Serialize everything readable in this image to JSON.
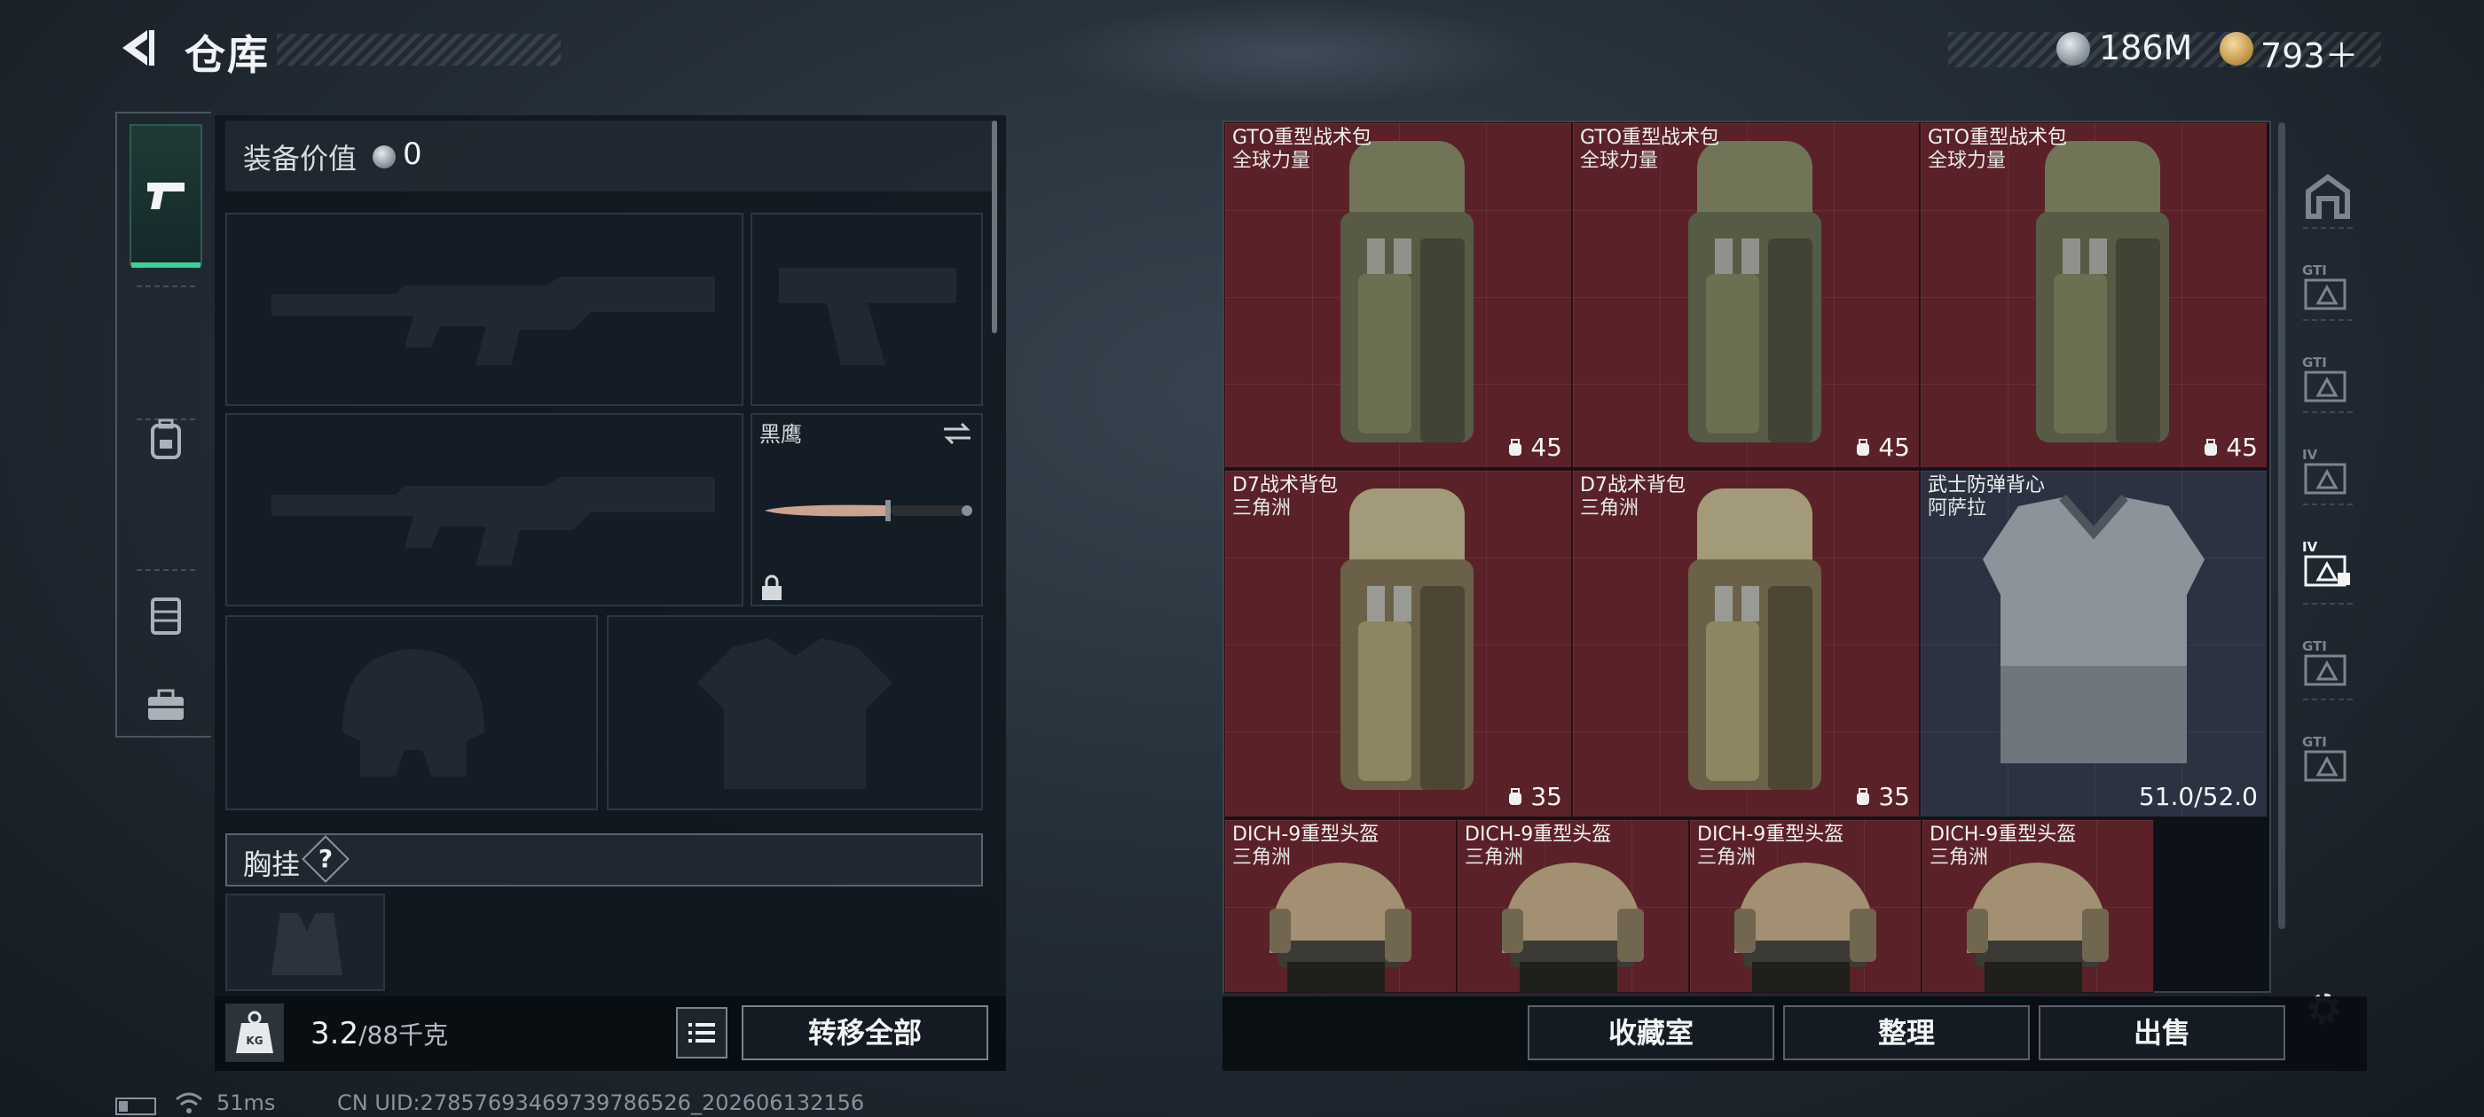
{
  "header": {
    "title": "仓库",
    "currency_silver": "186M",
    "currency_gold": "793＋"
  },
  "icons": {
    "back": "back-arrow-icon",
    "silver_coin": "silver-coin-icon",
    "gold_coin": "gold-coin-icon",
    "settings": "gear-icon"
  },
  "categories": [
    {
      "name": "weapons",
      "icon": "pistol-icon",
      "active": true
    },
    {
      "name": "backpack",
      "icon": "backpack-icon",
      "active": false
    },
    {
      "name": "vest",
      "icon": "chest-rig-icon",
      "active": false
    },
    {
      "name": "case",
      "icon": "briefcase-icon",
      "active": false
    }
  ],
  "loadout": {
    "value_label": "装备价值",
    "value": "0",
    "melee_name": "黑鹰",
    "chest_rig_label": "胸挂",
    "chest_rig_help": "?",
    "weight_current": "3.2",
    "weight_max": "/88千克",
    "weight_icon_text": "KG",
    "transfer_all": "转移全部"
  },
  "storage": {
    "items": [
      {
        "name": "GTO重型战术包",
        "brand": "全球力量",
        "meta": "45",
        "kind": "backpack"
      },
      {
        "name": "GTO重型战术包",
        "brand": "全球力量",
        "meta": "45",
        "kind": "backpack"
      },
      {
        "name": "GTO重型战术包",
        "brand": "全球力量",
        "meta": "45",
        "kind": "backpack"
      },
      {
        "name": "D7战术背包",
        "brand": "三角洲",
        "meta": "35",
        "kind": "backpack-tan"
      },
      {
        "name": "D7战术背包",
        "brand": "三角洲",
        "meta": "35",
        "kind": "backpack-tan"
      },
      {
        "name": "武士防弹背心",
        "brand": "阿萨拉",
        "meta": "51.0/52.0",
        "kind": "armor"
      },
      {
        "name": "DICH-9重型头盔",
        "brand": "三角洲",
        "meta": "",
        "kind": "helmet"
      },
      {
        "name": "DICH-9重型头盔",
        "brand": "三角洲",
        "meta": "",
        "kind": "helmet"
      },
      {
        "name": "DICH-9重型头盔",
        "brand": "三角洲",
        "meta": "",
        "kind": "helmet"
      },
      {
        "name": "DICH-9重型头盔",
        "brand": "三角洲",
        "meta": "",
        "kind": "helmet"
      }
    ]
  },
  "filters": [
    {
      "label": "",
      "icon": "all-items-icon"
    },
    {
      "label": "GTI",
      "icon": "rig-tier-icon"
    },
    {
      "label": "GTI",
      "icon": "armor-tier-icon"
    },
    {
      "label": "IV",
      "icon": "armor-tier-icon"
    },
    {
      "label": "IV",
      "icon": "armor-tier-active-icon"
    },
    {
      "label": "GTI",
      "icon": "rig-tier-icon"
    },
    {
      "label": "GTI",
      "icon": "rig-tier-icon"
    }
  ],
  "actions": {
    "collection": "收藏室",
    "organize": "整理",
    "sell": "出售"
  },
  "status": {
    "ping": "51ms",
    "uid": "CN UID:27857693469739786526_202606132156"
  }
}
